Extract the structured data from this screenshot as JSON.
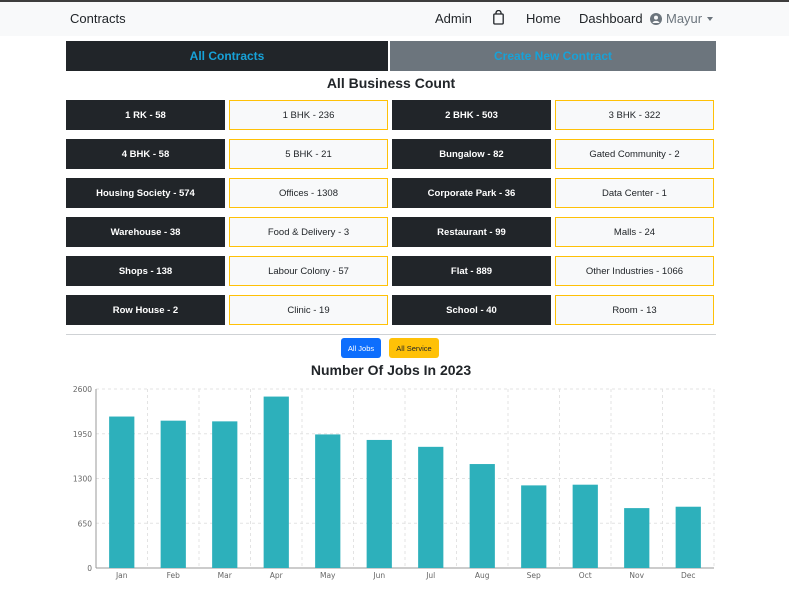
{
  "navbar": {
    "brand": "Contracts",
    "admin": "Admin",
    "bag_icon": "shopping-bag-icon",
    "home": "Home",
    "dashboard": "Dashboard",
    "user": "Mayur",
    "user_icon": "user-circle-icon"
  },
  "tabs": {
    "all": "All Contracts",
    "create": "Create New Contract"
  },
  "business": {
    "title": "All Business Count",
    "cells": [
      "1 RK - 58",
      "1 BHK - 236",
      "2 BHK - 503",
      "3 BHK - 322",
      "4 BHK - 58",
      "5 BHK - 21",
      "Bungalow - 82",
      "Gated Community - 2",
      "Housing Society - 574",
      "Offices - 1308",
      "Corporate Park - 36",
      "Data Center - 1",
      "Warehouse - 38",
      "Food & Delivery - 3",
      "Restaurant - 99",
      "Malls - 24",
      "Shops - 138",
      "Labour Colony - 57",
      "Flat - 889",
      "Other Industries - 1066",
      "Row House - 2",
      "Clinic - 19",
      "School - 40",
      "Room - 13"
    ]
  },
  "filters": {
    "all_jobs": "All Jobs",
    "all_service": "All Service"
  },
  "chart_data": {
    "type": "bar",
    "title": "Number Of Jobs In 2023",
    "categories": [
      "Jan",
      "Feb",
      "Mar",
      "Apr",
      "May",
      "Jun",
      "Jul",
      "Aug",
      "Sep",
      "Oct",
      "Nov",
      "Dec"
    ],
    "values": [
      2200,
      2140,
      2130,
      2490,
      1940,
      1860,
      1760,
      1510,
      1200,
      1210,
      870,
      890
    ],
    "ylim": [
      0,
      2600
    ],
    "yticks": [
      0,
      650,
      1300,
      1950,
      2600
    ],
    "grid": true,
    "bar_color": "#2db0bb"
  },
  "colors": {
    "dark": "#212529",
    "accent_border": "#ffc107",
    "tab_text": "#17a2d8",
    "primary": "#0d6efd"
  }
}
